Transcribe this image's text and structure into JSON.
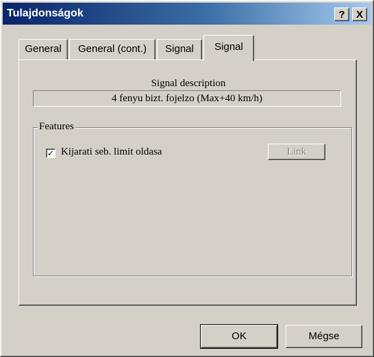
{
  "window": {
    "title": "Tulajdonságok",
    "help_label": "?",
    "close_label": "X"
  },
  "tabs": [
    {
      "label": "General",
      "active": false
    },
    {
      "label": "General (cont.)",
      "active": false
    },
    {
      "label": "Signal",
      "active": false
    },
    {
      "label": "Signal",
      "active": true
    }
  ],
  "panel": {
    "description_label": "Signal description",
    "description_value": "4 fenyu bizt. fojelzo (Max+40 km/h)",
    "features_group": {
      "legend": "Features",
      "checkbox_label": "Kijarati seb. limit oldasa",
      "checkbox_checked": true,
      "checkmark": "✓",
      "link_label": "Link",
      "link_enabled": false
    }
  },
  "buttons": {
    "ok_label": "OK",
    "cancel_label": "Mégse"
  }
}
